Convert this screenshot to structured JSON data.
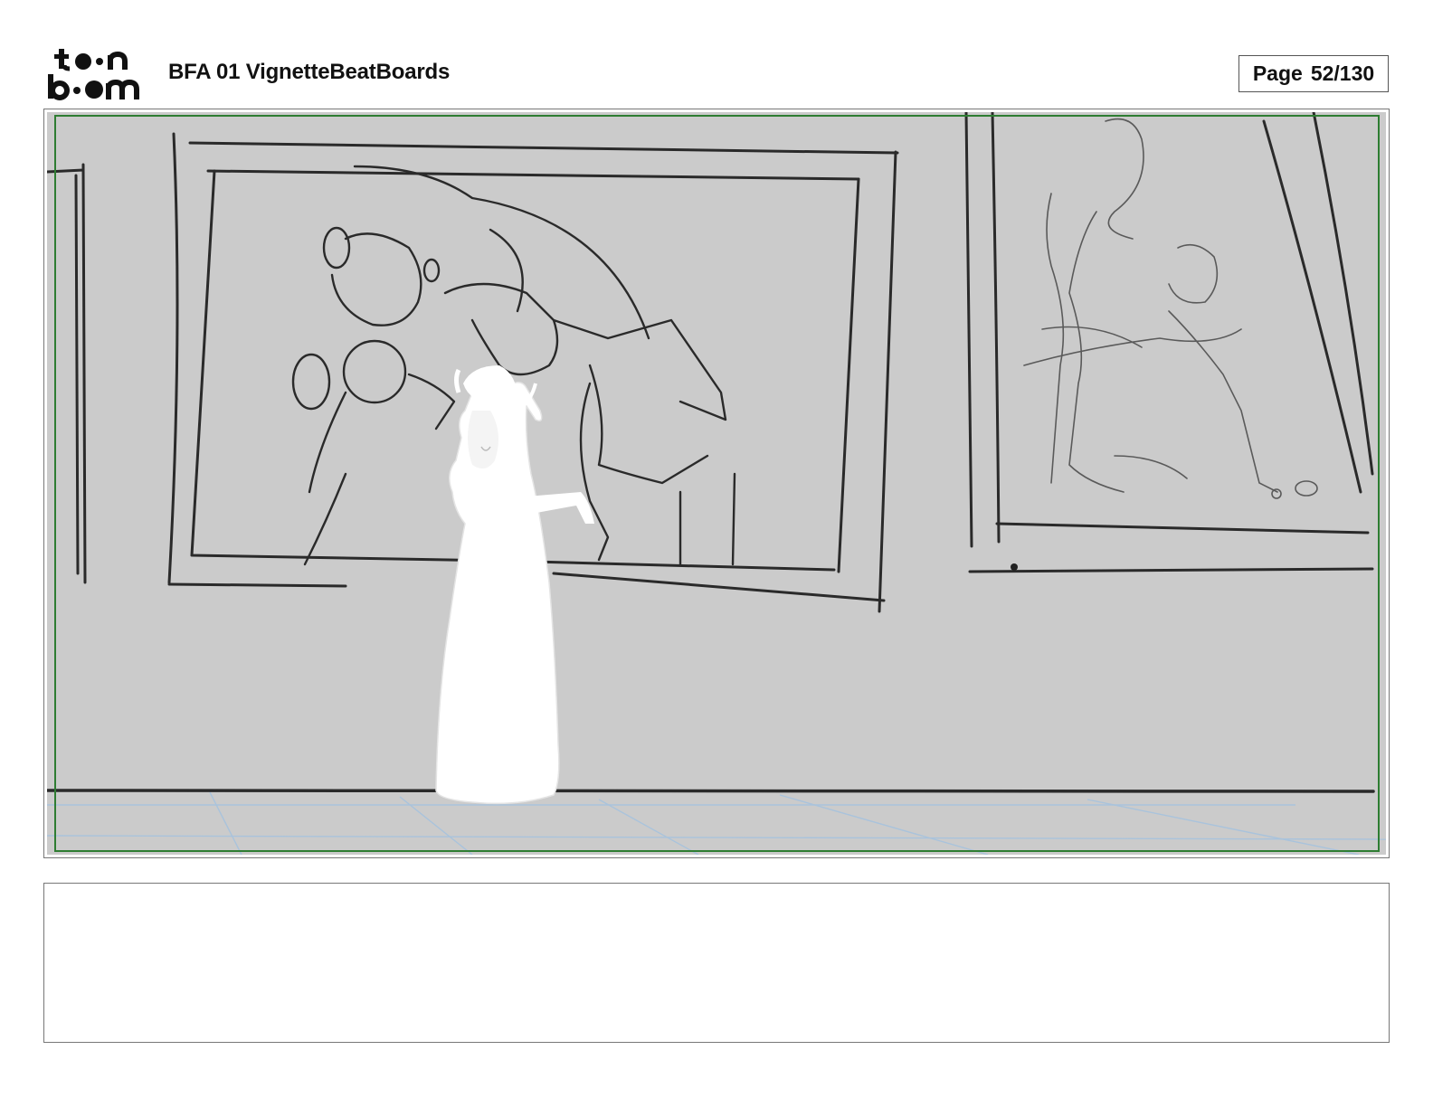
{
  "header": {
    "logo_text": "toon boom",
    "document_title": "BFA 01 VignetteBeatBoards",
    "page_label": "Page",
    "page_number": "52/130"
  },
  "panel": {
    "description_hidden": "",
    "notes": ""
  },
  "colors": {
    "panel_background": "#cbcbcb",
    "safe_frame": "#2e7d32",
    "border": "#777777"
  }
}
